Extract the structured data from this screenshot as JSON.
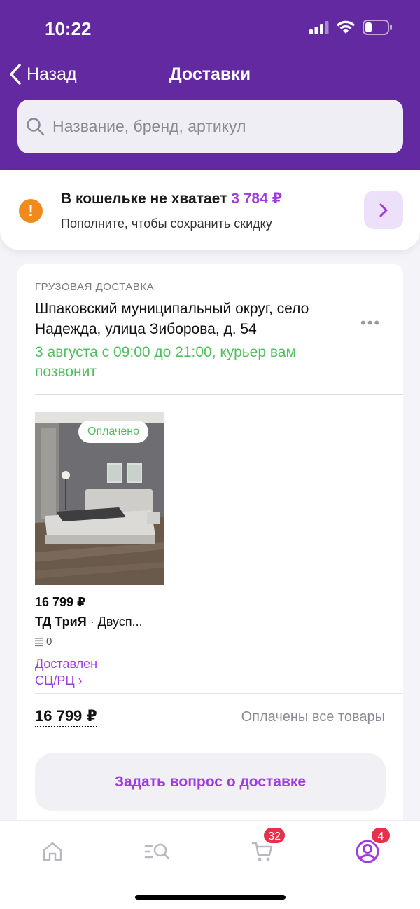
{
  "status_bar": {
    "time": "10:22"
  },
  "nav": {
    "back_label": "Назад",
    "title": "Доставки"
  },
  "search": {
    "placeholder": "Название, бренд, артикул"
  },
  "wallet": {
    "title": "В кошельке не хватает",
    "amount": "3 784 ₽",
    "subtitle": "Пополните, чтобы сохранить скидку"
  },
  "delivery": {
    "category": "ГРУЗОВАЯ ДОСТАВКА",
    "address": "Шпаковский муниципальный округ, село Надежда, улица Зиборова, д. 54",
    "date": "3 августа с 09:00 до 21:00, курьер вам позвонит",
    "item": {
      "paid_badge": "Оплачено",
      "price": "16 799 ₽",
      "brand": "ТД ТриЯ",
      "name_rest": " · Двусп...",
      "qty": "0",
      "status": "Доставлен",
      "location": "СЦ/РЦ ›"
    },
    "total": "16 799 ₽",
    "paid_all": "Оплачены все товары",
    "ask_button": "Задать вопрос о доставке"
  },
  "tabbar": {
    "cart_badge": "32",
    "profile_badge": "4"
  },
  "colors": {
    "header": "#6229a0",
    "accent": "#a03be0",
    "green": "#4fbf5d",
    "warning": "#f08a1c",
    "badge": "#e8304a"
  }
}
